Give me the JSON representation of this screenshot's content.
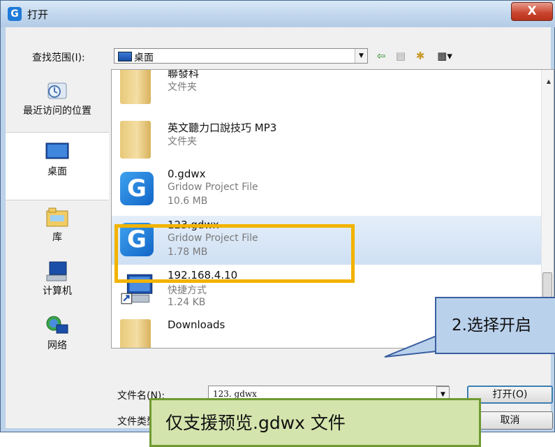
{
  "window": {
    "title": "打开",
    "close_label": "X"
  },
  "lookin": {
    "label": "查找范围(I):",
    "value": "桌面"
  },
  "places": [
    {
      "label": "最近访问的位置"
    },
    {
      "label": "桌面"
    },
    {
      "label": "库"
    },
    {
      "label": "计算机"
    },
    {
      "label": "网络"
    }
  ],
  "files": [
    {
      "name": "聯發科",
      "type": "文件夹",
      "size": ""
    },
    {
      "name": "英文聽力口說技巧 MP3",
      "type": "文件夹",
      "size": ""
    },
    {
      "name": "0.gdwx",
      "type": "Gridow Project File",
      "size": "10.6 MB"
    },
    {
      "name": "123.gdwx",
      "type": "Gridow Project File",
      "size": "1.78 MB"
    },
    {
      "name": "192.168.4.10",
      "type": "快捷方式",
      "size": "1.24 KB"
    },
    {
      "name": "Downloads",
      "type": "",
      "size": ""
    }
  ],
  "filename": {
    "label": "文件名(N):",
    "value": "123. gdwx"
  },
  "filetype": {
    "label": "文件类型(T):",
    "value": ""
  },
  "buttons": {
    "open": "打开(O)",
    "cancel": "取消"
  },
  "annotations": {
    "callout": "2.选择开启",
    "note": "仅支援预览.gdwx 文件"
  },
  "colors": {
    "highlight": "#f2b300",
    "callout_bg": "#bad1ec",
    "note_bg": "#d4e4ad"
  }
}
